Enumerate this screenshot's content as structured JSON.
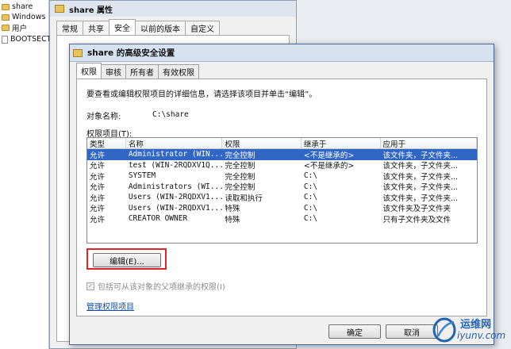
{
  "explorer": {
    "items": [
      {
        "label": "share",
        "kind": "folder"
      },
      {
        "label": "Windows",
        "kind": "folder"
      },
      {
        "label": "用户",
        "kind": "folder"
      },
      {
        "label": "BOOTSECT.",
        "kind": "file"
      }
    ]
  },
  "props_dialog": {
    "title": "share 属性",
    "tabs": [
      "常规",
      "共享",
      "安全",
      "以前的版本",
      "自定义"
    ]
  },
  "advanced_dialog": {
    "title": "share 的高级安全设置",
    "tabs": [
      "权限",
      "审核",
      "所有者",
      "有效权限"
    ],
    "instruction": "要查看或编辑权限项目的详细信息，请选择该项目并单击“编辑”。",
    "object_name_label": "对象名称:",
    "object_name_value": "C:\\share",
    "entries_label": "权限项目(T):",
    "columns": [
      "类型",
      "名称",
      "权限",
      "继承于",
      "应用于"
    ],
    "rows": [
      {
        "type": "允许",
        "name": "Administrator (WIN...",
        "perm": "完全控制",
        "inherited": "<不是继承的>",
        "applies": "该文件夹，子文件夹..."
      },
      {
        "type": "允许",
        "name": "test (WIN-2RQDXV1Q...",
        "perm": "完全控制",
        "inherited": "<不是继承的>",
        "applies": "该文件夹，子文件夹..."
      },
      {
        "type": "允许",
        "name": "SYSTEM",
        "perm": "完全控制",
        "inherited": "C:\\",
        "applies": "该文件夹，子文件夹..."
      },
      {
        "type": "允许",
        "name": "Administrators (WI...",
        "perm": "完全控制",
        "inherited": "C:\\",
        "applies": "该文件夹，子文件夹..."
      },
      {
        "type": "允许",
        "name": "Users (WIN-2RQDXV1...",
        "perm": "读取和执行",
        "inherited": "C:\\",
        "applies": "该文件夹，子文件夹..."
      },
      {
        "type": "允许",
        "name": "Users (WIN-2RQDXV1...",
        "perm": "特殊",
        "inherited": "C:\\",
        "applies": "该文件夹及子文件夹"
      },
      {
        "type": "允许",
        "name": "CREATOR OWNER",
        "perm": "特殊",
        "inherited": "C:\\",
        "applies": "只有子文件夹及文件"
      }
    ],
    "edit_button": "编辑(E)...",
    "include_inherit_label": "包括可从该对象的父项继承的权限(I)",
    "manage_link": "管理权限项目",
    "ok_button": "确定",
    "cancel_button": "取消"
  },
  "watermark": {
    "text1": "运维网",
    "text2": "iyunv.com"
  },
  "colors": {
    "selection": "#3167c4",
    "highlight_box": "#e0242b",
    "link": "#0b4fa8"
  }
}
